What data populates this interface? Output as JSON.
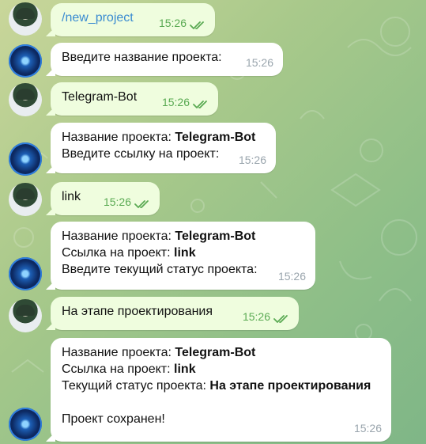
{
  "messages": [
    {
      "from": "user",
      "lines": [
        {
          "text": "/new_project",
          "link": true
        }
      ],
      "time": "15:26",
      "read": true
    },
    {
      "from": "bot",
      "lines": [
        {
          "text": "Введите название проекта:"
        }
      ],
      "time": "15:26"
    },
    {
      "from": "user",
      "lines": [
        {
          "text": "Telegram-Bot"
        }
      ],
      "time": "15:26",
      "read": true
    },
    {
      "from": "bot",
      "lines": [
        {
          "label": "Название проекта: ",
          "value": "Telegram-Bot"
        },
        {
          "text": "Введите ссылку на проект:"
        }
      ],
      "time": "15:26"
    },
    {
      "from": "user",
      "lines": [
        {
          "text": "link"
        }
      ],
      "time": "15:26",
      "read": true
    },
    {
      "from": "bot",
      "lines": [
        {
          "label": "Название проекта: ",
          "value": "Telegram-Bot"
        },
        {
          "label": "Ссылка на проект: ",
          "value": "link"
        },
        {
          "text": "Введите текущий статус проекта:"
        }
      ],
      "time": "15:26"
    },
    {
      "from": "user",
      "lines": [
        {
          "text": "На этапе проектирования"
        }
      ],
      "time": "15:26",
      "read": true
    },
    {
      "from": "bot",
      "lines": [
        {
          "label": "Название проекта: ",
          "value": "Telegram-Bot"
        },
        {
          "label": "Ссылка на проект: ",
          "value": "link"
        },
        {
          "label": "Текущий статус проекта: ",
          "value": "На этапе проектирования"
        },
        {
          "text": ""
        },
        {
          "text": "Проект сохранен!"
        }
      ],
      "time": "15:26"
    }
  ],
  "colors": {
    "out_bubble": "#effdde",
    "in_bubble": "#ffffff",
    "check": "#5aaa53",
    "link": "#3a8bd1"
  },
  "icons": {
    "read_status": "double-check-icon",
    "user_avatar": "user-avatar",
    "bot_avatar": "bot-avatar"
  }
}
